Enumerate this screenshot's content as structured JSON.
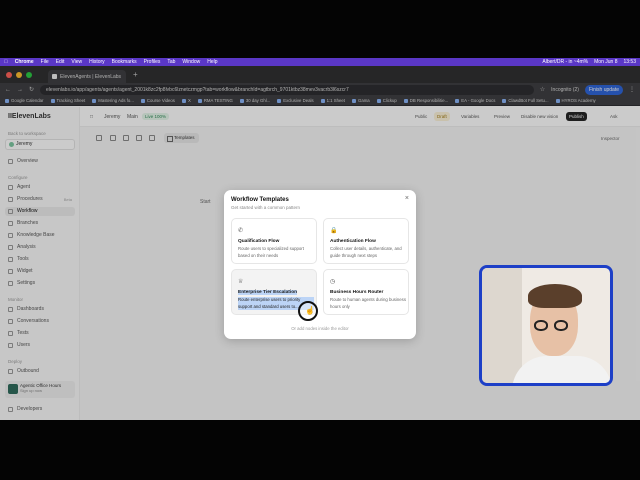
{
  "menubar": {
    "items": [
      "Chrome",
      "File",
      "Edit",
      "View",
      "History",
      "Bookmarks",
      "Profiles",
      "Tab",
      "Window",
      "Help"
    ],
    "right": [
      "Albert/DR - in ~4m%",
      "Mon Jun 8",
      "13:53"
    ]
  },
  "browser": {
    "tab_title": "ElevenAgents | ElevenLabs",
    "url": "elevenlabs.io/app/agents/agents/agent_2001k8zc2fp8lvbc6lznetczmgp?tab=workflow&branchId=agtbrch_9701ktbz38mev3vacrb3l6szcr7",
    "incognito": "Incognito (2)",
    "finish_update": "Finish update"
  },
  "bookmarks": [
    "Google Calendar",
    "Tracking Sheet",
    "Mastering Ads fo...",
    "Course Videos",
    "X",
    "RMA TESTING",
    "30 day Ghl...",
    "Exclusive Deals",
    "1:1 Sheet",
    "Gama",
    "Clickup",
    "DB Responsibilitie...",
    "EA - Google Docs",
    "ClawdBot Full Setu...",
    "HYROS Academy"
  ],
  "sidebar": {
    "logo": "IIElevenLabs",
    "workspace_label": "Back to workspace",
    "workspace": "Jeremy",
    "items": [
      {
        "label": "Overview"
      },
      {
        "label": "Agent"
      },
      {
        "label": "Procedures",
        "soon": "Beta"
      },
      {
        "label": "Workflow"
      },
      {
        "label": "Branches"
      },
      {
        "label": "Knowledge Base"
      },
      {
        "label": "Analysis"
      },
      {
        "label": "Tools"
      },
      {
        "label": "Widget"
      },
      {
        "label": "Settings"
      }
    ],
    "group_configure": "Configure",
    "group_monitor": "Monitor",
    "group_deploy": "Deploy",
    "monitor_items": [
      "Dashboards",
      "Conversations",
      "Tests",
      "Users"
    ],
    "deploy_items": [
      "Outbound"
    ],
    "agent_card": {
      "name": "Agentic Office Hours",
      "sub": "Sign up now"
    },
    "developers": "Developers"
  },
  "topbar": {
    "agent": "Jeremy",
    "branch": "Main",
    "badge": "Live 100%",
    "buttons": [
      "Public",
      "Draft",
      "Variables",
      "Preview",
      "Disable new vision",
      "Publish",
      "Ask"
    ]
  },
  "canvas": {
    "templates_button": "Templates",
    "inspector": "Inspector",
    "start_node": "Start"
  },
  "modal": {
    "title": "Workflow Templates",
    "subtitle": "Get started with a common pattern",
    "cards": [
      {
        "icon": "phone-icon",
        "title": "Qualification Flow",
        "desc": "Route users to specialized support based on their needs"
      },
      {
        "icon": "lock-icon",
        "title": "Authentication Flow",
        "desc": "Collect user details, authenticate, and guide through next steps"
      },
      {
        "icon": "crown-icon",
        "title": "Enterprise Tier Escalation",
        "desc": "Route enterprise users to priority support and standard users to..."
      },
      {
        "icon": "clock-icon",
        "title": "Business Hours Router",
        "desc": "Route to human agents during business hours only"
      }
    ],
    "footer": "Or add nodes inside the editor"
  }
}
